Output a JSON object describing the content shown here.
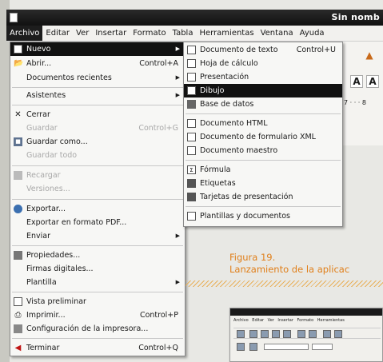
{
  "window": {
    "title": "Sin nomb"
  },
  "menubar": [
    {
      "label": "Archivo",
      "active": true
    },
    {
      "label": "Editar"
    },
    {
      "label": "Ver"
    },
    {
      "label": "Insertar"
    },
    {
      "label": "Formato"
    },
    {
      "label": "Tabla"
    },
    {
      "label": "Herramientas"
    },
    {
      "label": "Ventana"
    },
    {
      "label": "Ayuda"
    }
  ],
  "file_menu": {
    "items": [
      {
        "label": "Nuevo",
        "icon": "new-document-icon",
        "submenu": true,
        "selected": true
      },
      {
        "label": "Abrir...",
        "icon": "open-folder-icon",
        "accel": "Control+A"
      },
      {
        "label": "Documentos recientes",
        "submenu": true
      },
      {
        "label": "Asistentes",
        "submenu": true
      },
      {
        "label": "Cerrar",
        "icon": "close-icon"
      },
      {
        "label": "Guardar",
        "accel": "Control+G",
        "disabled": true
      },
      {
        "label": "Guardar como...",
        "icon": "save-as-icon"
      },
      {
        "label": "Guardar todo",
        "disabled": true
      },
      {
        "label": "Recargar",
        "icon": "reload-icon",
        "disabled": true
      },
      {
        "label": "Versiones...",
        "disabled": true
      },
      {
        "label": "Exportar...",
        "icon": "export-icon"
      },
      {
        "label": "Exportar en formato PDF..."
      },
      {
        "label": "Enviar",
        "submenu": true
      },
      {
        "label": "Propiedades...",
        "icon": "properties-icon"
      },
      {
        "label": "Firmas digitales..."
      },
      {
        "label": "Plantilla",
        "submenu": true
      },
      {
        "label": "Vista preliminar",
        "icon": "checkbox-icon"
      },
      {
        "label": "Imprimir...",
        "icon": "printer-icon",
        "accel": "Control+P"
      },
      {
        "label": "Configuración de la impresora...",
        "icon": "printer-settings-icon"
      },
      {
        "label": "Terminar",
        "icon": "exit-icon",
        "accel": "Control+Q"
      }
    ]
  },
  "new_submenu": {
    "items": [
      {
        "label": "Documento de texto",
        "icon": "text-document-icon",
        "accel": "Control+U"
      },
      {
        "label": "Hoja de cálculo",
        "icon": "spreadsheet-icon"
      },
      {
        "label": "Presentación",
        "icon": "presentation-icon"
      },
      {
        "label": "Dibujo",
        "icon": "drawing-icon",
        "selected": true
      },
      {
        "label": "Base de datos",
        "icon": "database-icon"
      },
      {
        "label": "Documento HTML",
        "icon": "html-document-icon"
      },
      {
        "label": "Documento de formulario XML",
        "icon": "xml-form-icon"
      },
      {
        "label": "Documento maestro",
        "icon": "master-document-icon"
      },
      {
        "label": "Fórmula",
        "icon": "formula-icon"
      },
      {
        "label": "Etiquetas",
        "icon": "labels-icon"
      },
      {
        "label": "Tarjetas de presentación",
        "icon": "business-cards-icon"
      },
      {
        "label": "Plantillas y documentos",
        "icon": "templates-icon"
      }
    ]
  },
  "toolbar": {
    "bold_label": "A",
    "italic_label": "A",
    "ruler_text": "7 · · · 8"
  },
  "caption": {
    "line1": "Figura 19.",
    "line2": "Lanzamiento de la aplicac"
  },
  "mini_screenshot": {
    "menu_text": "Archivo Editar Ver Insertar Formato Herramientas"
  },
  "colors": {
    "caption": "#e07f1a",
    "selection": "#111111",
    "titlebar": "#1a1a1a"
  }
}
